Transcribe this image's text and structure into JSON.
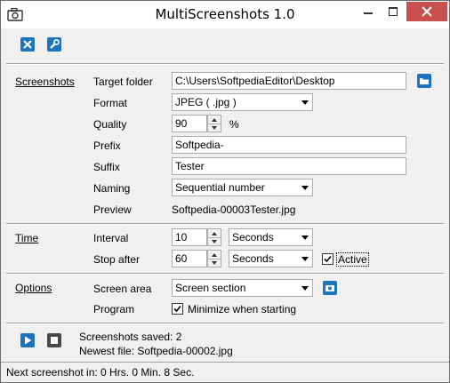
{
  "window": {
    "title": "MultiScreenshots 1.0",
    "icon": "camera-icon"
  },
  "titlebar_buttons": {
    "minimize": "minimize-icon",
    "maximize": "maximize-icon",
    "close": "close-icon"
  },
  "toolbar": {
    "buttons": [
      {
        "name": "close-tool-button",
        "icon": "x-icon"
      },
      {
        "name": "settings-tool-button",
        "icon": "wrench-icon"
      }
    ]
  },
  "sections": {
    "screenshots": "Screenshots",
    "time": "Time",
    "options": "Options"
  },
  "screenshots": {
    "target_folder_label": "Target folder",
    "target_folder_value": "C:\\Users\\SoftpediaEditor\\Desktop",
    "format_label": "Format",
    "format_value": "JPEG ( .jpg )",
    "quality_label": "Quality",
    "quality_value": "90",
    "quality_unit": "%",
    "prefix_label": "Prefix",
    "prefix_value": "Softpedia-",
    "suffix_label": "Suffix",
    "suffix_value": "Tester",
    "naming_label": "Naming",
    "naming_value": "Sequential number",
    "preview_label": "Preview",
    "preview_value": "Softpedia-00003Tester.jpg"
  },
  "time": {
    "interval_label": "Interval",
    "interval_value": "10",
    "interval_unit": "Seconds",
    "stop_after_label": "Stop after",
    "stop_after_value": "60",
    "stop_after_unit": "Seconds",
    "active_label": "Active",
    "active_checked": true
  },
  "options": {
    "screen_area_label": "Screen area",
    "screen_area_value": "Screen section",
    "program_label": "Program",
    "minimize_label": "Minimize when starting",
    "minimize_checked": true
  },
  "status": {
    "saved_text": "Screenshots saved: 2",
    "newest_text": "Newest file: Softpedia-00002.jpg",
    "next_text": "Next screenshot in: 0 Hrs. 0 Min. 8 Sec."
  },
  "colors": {
    "accent": "#1e73be",
    "close": "#c7504d"
  }
}
